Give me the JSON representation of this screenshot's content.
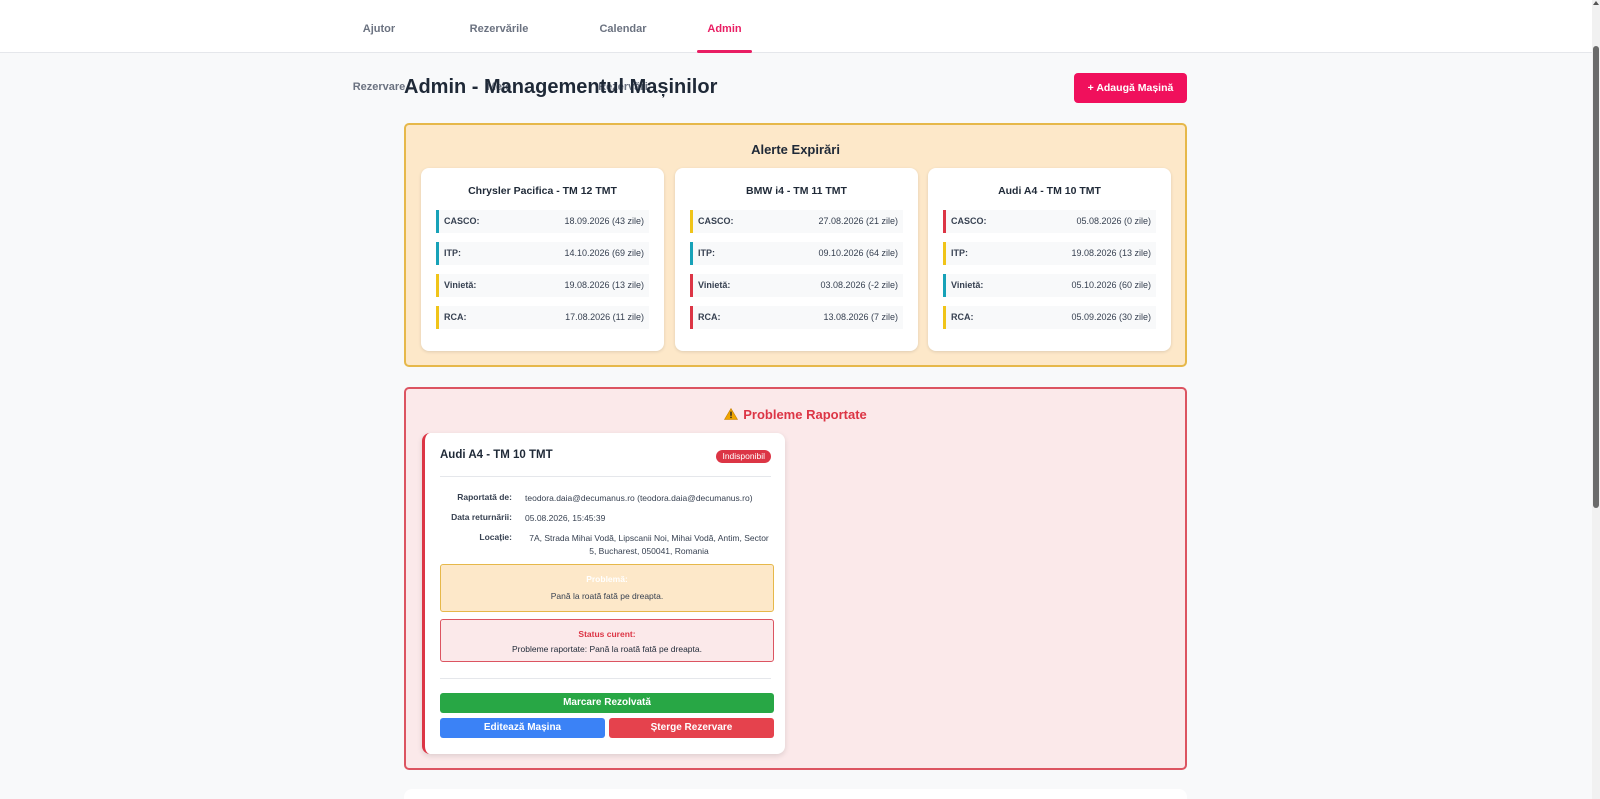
{
  "nav": {
    "tabs": [
      {
        "label": "Ajutor Rezervare"
      },
      {
        "label": "Rezervările Mele"
      },
      {
        "label": "Calendar Rezervări"
      },
      {
        "label": "Admin"
      }
    ],
    "active_tab": "Admin"
  },
  "header": {
    "title": "Admin - Managementul Mașinilor",
    "add_button": "+ Adaugă Mașină"
  },
  "alerts": {
    "title": "Alerte Expirări",
    "cars": [
      {
        "name": "Chrysler Pacifica - TM 12 TMT",
        "items": [
          {
            "label": "CASCO:",
            "value": "18.09.2026 (43 zile)",
            "status": "info"
          },
          {
            "label": "ITP:",
            "value": "14.10.2026 (69 zile)",
            "status": "info"
          },
          {
            "label": "Vinietă:",
            "value": "19.08.2026 (13 zile)",
            "status": "warning"
          },
          {
            "label": "RCA:",
            "value": "17.08.2026 (11 zile)",
            "status": "warning"
          }
        ]
      },
      {
        "name": "BMW i4 - TM 11 TMT",
        "items": [
          {
            "label": "CASCO:",
            "value": "27.08.2026 (21 zile)",
            "status": "warning"
          },
          {
            "label": "ITP:",
            "value": "09.10.2026 (64 zile)",
            "status": "info"
          },
          {
            "label": "Vinietă:",
            "value": "03.08.2026 (-2 zile)",
            "status": "danger"
          },
          {
            "label": "RCA:",
            "value": "13.08.2026 (7 zile)",
            "status": "danger"
          }
        ]
      },
      {
        "name": "Audi A4 - TM 10 TMT",
        "items": [
          {
            "label": "CASCO:",
            "value": "05.08.2026 (0 zile)",
            "status": "danger"
          },
          {
            "label": "ITP:",
            "value": "19.08.2026 (13 zile)",
            "status": "warning"
          },
          {
            "label": "Vinietă:",
            "value": "05.10.2026 (60 zile)",
            "status": "info"
          },
          {
            "label": "RCA:",
            "value": "05.09.2026 (30 zile)",
            "status": "warning"
          }
        ]
      }
    ]
  },
  "problems": {
    "title": "Probleme Raportate",
    "icon": "warning-icon",
    "report": {
      "car": "Audi A4 - TM 10 TMT",
      "badge": "Indisponibil",
      "reported_by_label": "Raportată de:",
      "reported_by": "teodora.daia@decumanus.ro (teodora.daia@decumanus.ro)",
      "return_date_label": "Data returnării:",
      "return_date": "05.08.2026, 15:45:39",
      "location_label": "Locație:",
      "location": "7A, Strada Mihai Vodă, Lipscanii Noi, Mihai Vodă, Antim, Sector 5, Bucharest, 050041, Romania",
      "problem_heading": "Problemă:",
      "problem_text": "Pană la roată fată pe dreapta.",
      "status_heading": "Status curent:",
      "status_text": "Probleme raportate: Pană la roată fată pe dreapta.",
      "resolve_button": "Marcare Rezolvată",
      "edit_button": "Editează Mașina",
      "delete_button": "Șterge Rezervare"
    }
  },
  "colors": {
    "accent": "#e91e63",
    "danger": "#dc3545",
    "warning": "#f0c419",
    "info": "#17a2b8",
    "success": "#28a745",
    "primary": "#3b82f6"
  }
}
